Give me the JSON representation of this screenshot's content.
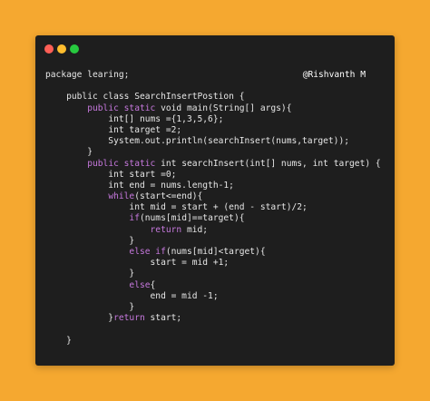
{
  "window": {
    "traffic_lights": [
      {
        "name": "close",
        "color": "#ff5f56"
      },
      {
        "name": "minimize",
        "color": "#ffbd2e"
      },
      {
        "name": "zoom",
        "color": "#27c93f"
      }
    ]
  },
  "header": {
    "author": "@Rishvanth M"
  },
  "code": {
    "lines": [
      [
        {
          "t": "package learing;",
          "c": "pl"
        }
      ],
      [],
      [
        {
          "t": "    public class SearchInsertPostion {",
          "c": "pl"
        }
      ],
      [
        {
          "t": "        ",
          "c": "pl"
        },
        {
          "t": "public static",
          "c": "kw"
        },
        {
          "t": " void ",
          "c": "pl"
        },
        {
          "t": "main(String[] args){",
          "c": "pl"
        }
      ],
      [
        {
          "t": "            ",
          "c": "pl"
        },
        {
          "t": "int",
          "c": "pl"
        },
        {
          "t": "[] nums ={1,3,5,6};",
          "c": "pl"
        }
      ],
      [
        {
          "t": "            ",
          "c": "pl"
        },
        {
          "t": "int",
          "c": "pl"
        },
        {
          "t": " target =2;",
          "c": "pl"
        }
      ],
      [
        {
          "t": "            System.out.println(searchInsert(nums,target));",
          "c": "pl"
        }
      ],
      [
        {
          "t": "        }",
          "c": "pl"
        }
      ],
      [
        {
          "t": "        ",
          "c": "pl"
        },
        {
          "t": "public static",
          "c": "kw"
        },
        {
          "t": " int searchInsert(int[] nums, int target) {",
          "c": "pl"
        }
      ],
      [
        {
          "t": "            int start =0;",
          "c": "pl"
        }
      ],
      [
        {
          "t": "            int end = nums.length-1;",
          "c": "pl"
        }
      ],
      [
        {
          "t": "            ",
          "c": "pl"
        },
        {
          "t": "while",
          "c": "kw"
        },
        {
          "t": "(start<=end){",
          "c": "pl"
        }
      ],
      [
        {
          "t": "                int mid = start + (end - start)/2;",
          "c": "pl"
        }
      ],
      [
        {
          "t": "                ",
          "c": "pl"
        },
        {
          "t": "if",
          "c": "kw"
        },
        {
          "t": "(nums[mid]==target){",
          "c": "pl"
        }
      ],
      [
        {
          "t": "                    ",
          "c": "pl"
        },
        {
          "t": "return",
          "c": "kw"
        },
        {
          "t": " mid;",
          "c": "pl"
        }
      ],
      [
        {
          "t": "                }",
          "c": "pl"
        }
      ],
      [
        {
          "t": "                ",
          "c": "pl"
        },
        {
          "t": "else if",
          "c": "kw"
        },
        {
          "t": "(nums[mid]<target){",
          "c": "pl"
        }
      ],
      [
        {
          "t": "                    start = mid +1;",
          "c": "pl"
        }
      ],
      [
        {
          "t": "                }",
          "c": "pl"
        }
      ],
      [
        {
          "t": "                ",
          "c": "pl"
        },
        {
          "t": "else",
          "c": "kw"
        },
        {
          "t": "{",
          "c": "pl"
        }
      ],
      [
        {
          "t": "                    end = mid -1;",
          "c": "pl"
        }
      ],
      [
        {
          "t": "                }",
          "c": "pl"
        }
      ],
      [
        {
          "t": "            }",
          "c": "pl"
        },
        {
          "t": "return",
          "c": "kw"
        },
        {
          "t": " start;",
          "c": "pl"
        }
      ],
      [],
      [
        {
          "t": "    }",
          "c": "pl"
        }
      ]
    ]
  }
}
